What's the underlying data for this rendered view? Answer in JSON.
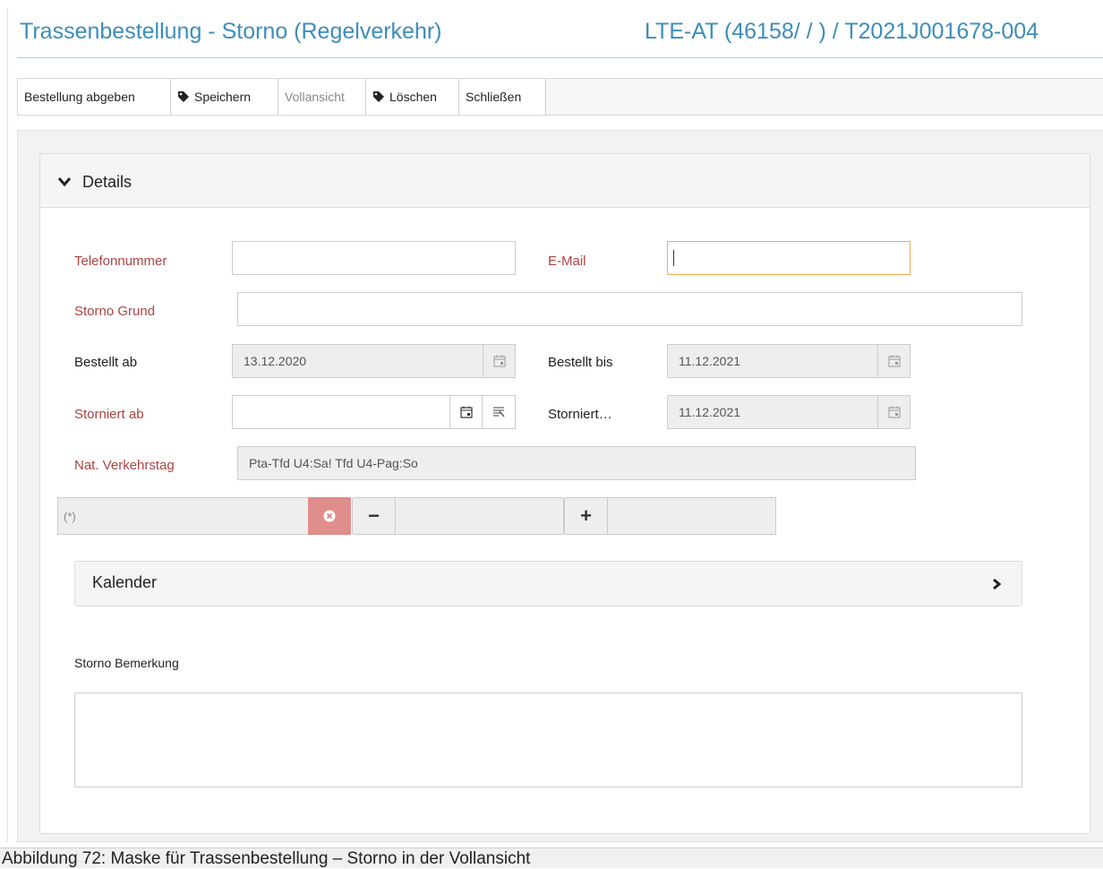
{
  "header": {
    "title": "Trassenbestellung - Storno (Regelverkehr)",
    "reference": "LTE-AT (46158/ / ) / T2021J001678-004"
  },
  "toolbar": {
    "submit_label": "Bestellung abgeben",
    "save_label": "Speichern",
    "fullview_label": "Vollansicht",
    "delete_label": "Löschen",
    "close_label": "Schließen"
  },
  "details": {
    "heading": "Details",
    "phone_label": "Telefonnummer",
    "phone_value": "",
    "email_label": "E-Mail",
    "email_value": "",
    "reason_label": "Storno Grund",
    "reason_value": "",
    "ordered_from_label": "Bestellt ab",
    "ordered_from_value": "13.12.2020",
    "ordered_to_label": "Bestellt bis",
    "ordered_to_value": "11.12.2021",
    "cancelled_from_label": "Storniert ab",
    "cancelled_from_value": "",
    "cancelled_to_label": "Storniert…",
    "cancelled_to_value": "11.12.2021",
    "traffic_day_label": "Nat. Verkehrstag",
    "traffic_day_value": "Pta-Tfd U4:Sa! Tfd U4-Pag:So",
    "filter_value": "(*)",
    "minus_label": "−",
    "plus_label": "+",
    "calendar_label": "Kalender",
    "remark_label": "Storno Bemerkung",
    "remark_value": ""
  },
  "caption": "Abbildung 72: Maske für Trassenbestellung – Storno in der Vollansicht",
  "colors": {
    "accent": "#3c8dbc",
    "required_label": "#a94442",
    "clear_button": "#e08e8b",
    "focus_border": "#f0ad4e"
  }
}
